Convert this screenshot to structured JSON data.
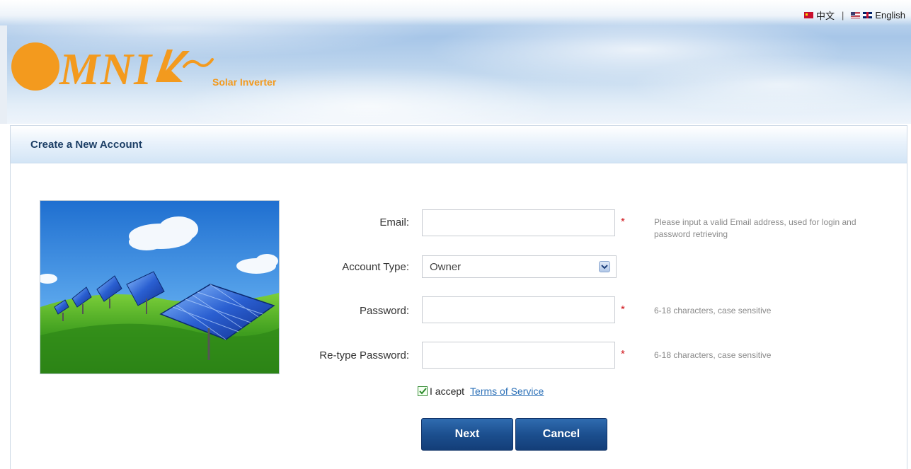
{
  "language_bar": {
    "chinese_label": "中文",
    "separator": "|",
    "english_label": "English"
  },
  "brand": {
    "logo_text": "MNI",
    "tagline": "Solar Inverter",
    "color": "#f39a1e"
  },
  "panel": {
    "title": "Create a New Account"
  },
  "form": {
    "email": {
      "label": "Email:",
      "value": "",
      "required_mark": "*",
      "hint": "Please input a valid Email address, used for login and password retrieving"
    },
    "account_type": {
      "label": "Account Type:",
      "selected": "Owner"
    },
    "password": {
      "label": "Password:",
      "value": "",
      "required_mark": "*",
      "hint": "6-18 characters, case sensitive"
    },
    "retype_password": {
      "label": "Re-type Password:",
      "value": "",
      "required_mark": "*",
      "hint": "6-18 characters, case sensitive"
    },
    "accept": {
      "checked": true,
      "label": "I accept",
      "link_text": "Terms of Service"
    },
    "next_label": "Next",
    "cancel_label": "Cancel"
  }
}
